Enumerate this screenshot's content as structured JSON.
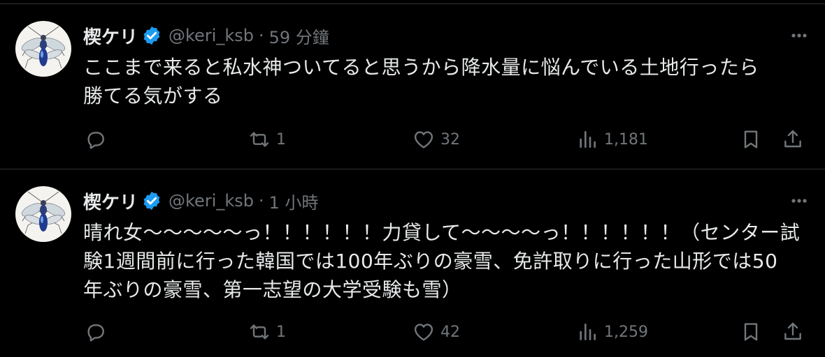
{
  "tweets": [
    {
      "display_name": "楔ケリ",
      "handle": "@keri_ksb",
      "separator": "·",
      "time": "59 分鐘",
      "lines": [
        "ここまで来ると私水神ついてると思うから降水量に悩んでいる土地行ったら",
        "勝てる気がする"
      ],
      "retweets": "1",
      "likes": "32",
      "views": "1,181"
    },
    {
      "display_name": "楔ケリ",
      "handle": "@keri_ksb",
      "separator": "·",
      "time": "1 小時",
      "lines": [
        "晴れ女〜〜〜〜〜っ！！！！！！力貸して〜〜〜〜っ！！！！！！（センター試",
        "験1週間前に行った韓国では100年ぶりの豪雪、免許取りに行った山形では50",
        "年ぶりの豪雪、第一志望の大学受験も雪）"
      ],
      "retweets": "1",
      "likes": "42",
      "views": "1,259"
    }
  ],
  "icons": {
    "verified": "verified-badge-icon",
    "more": "more-icon",
    "reply": "reply-icon",
    "retweet": "retweet-icon",
    "like": "heart-icon",
    "views": "analytics-icon",
    "bookmark": "bookmark-icon",
    "share": "share-icon"
  },
  "colors": {
    "background": "#000000",
    "text": "#e7e9ea",
    "secondary": "#71767b",
    "verified": "#1d9bf0",
    "divider": "#2f3336"
  }
}
